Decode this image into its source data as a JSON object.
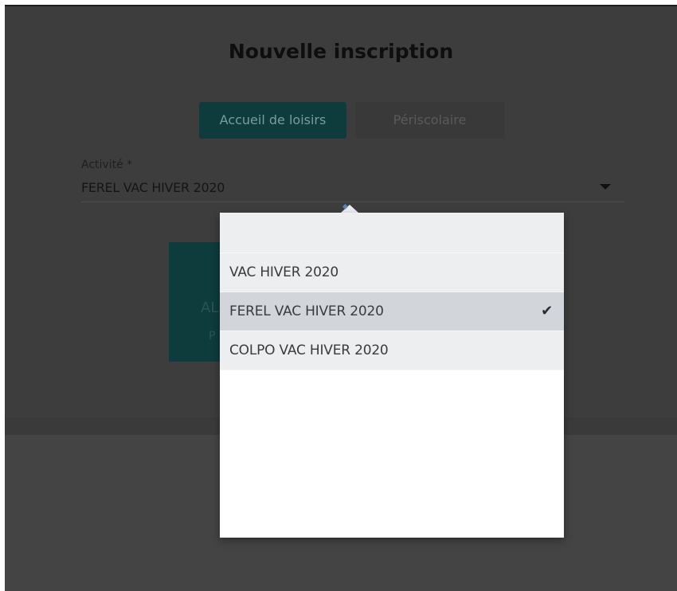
{
  "dialog": {
    "title": "Nouvelle inscription"
  },
  "tabs": [
    {
      "label": "Accueil de loisirs",
      "active": true
    },
    {
      "label": "Périscolaire",
      "active": false
    }
  ],
  "activity_field": {
    "label": "Activité *",
    "value": "FEREL VAC HIVER 2020"
  },
  "card": {
    "text_primary": "AL",
    "text_secondary": "P"
  },
  "dropdown": {
    "options": [
      {
        "label": "VAC HIVER 2020",
        "selected": false
      },
      {
        "label": "FEREL VAC HIVER 2020",
        "selected": true
      },
      {
        "label": "COLPO VAC HIVER 2020",
        "selected": false
      }
    ],
    "selected_icon": "check-icon"
  },
  "colors": {
    "accent": "#0e3b3c",
    "overlay": "#3d3d3d",
    "dropdown_bg": "#eceef0",
    "selected_bg": "#d2d6db"
  }
}
